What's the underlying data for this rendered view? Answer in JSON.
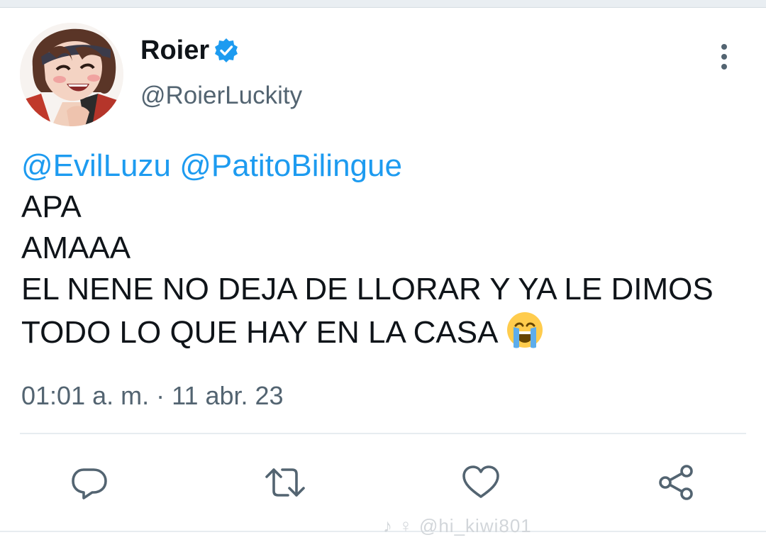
{
  "tweet": {
    "display_name": "Roier",
    "verified": true,
    "handle": "@RoierLuckity",
    "mentions": [
      "@EvilLuzu",
      "@PatitoBilingue"
    ],
    "lines": [
      "APA",
      "AMAAA",
      "EL NENE NO DEJA DE LLORAR Y YA LE DIMOS",
      "TODO LO QUE HAY EN LA CASA"
    ],
    "emoji": "loudly-crying-face",
    "timestamp": "01:01 a. m. · 11 abr. 23"
  },
  "actions": {
    "reply_icon": "speech-bubble-icon",
    "retweet_icon": "retweet-arrows-icon",
    "like_icon": "heart-icon",
    "share_icon": "share-nodes-icon"
  },
  "watermark": "♪ ♀ @hi_kiwi801",
  "colors": {
    "accent": "#1d9bf0",
    "text": "#0f1419",
    "muted": "#536471",
    "divider": "#e7ecf0"
  }
}
